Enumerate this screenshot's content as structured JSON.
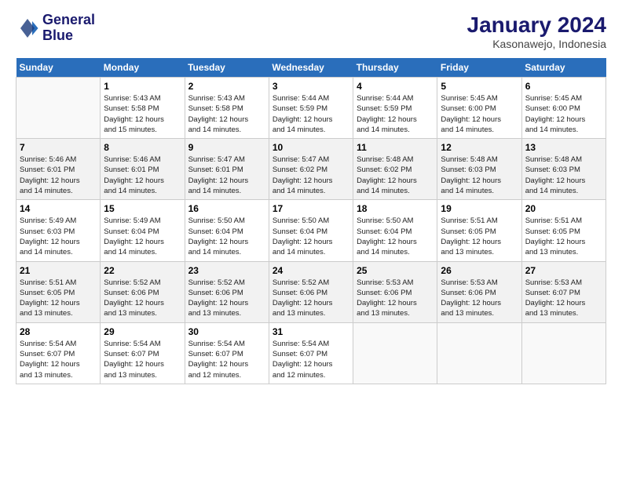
{
  "app": {
    "logo_line1": "General",
    "logo_line2": "Blue"
  },
  "calendar": {
    "title": "January 2024",
    "subtitle": "Kasonawejo, Indonesia",
    "headers": [
      "Sunday",
      "Monday",
      "Tuesday",
      "Wednesday",
      "Thursday",
      "Friday",
      "Saturday"
    ],
    "weeks": [
      [
        {
          "num": "",
          "info": ""
        },
        {
          "num": "1",
          "info": "Sunrise: 5:43 AM\nSunset: 5:58 PM\nDaylight: 12 hours\nand 15 minutes."
        },
        {
          "num": "2",
          "info": "Sunrise: 5:43 AM\nSunset: 5:58 PM\nDaylight: 12 hours\nand 14 minutes."
        },
        {
          "num": "3",
          "info": "Sunrise: 5:44 AM\nSunset: 5:59 PM\nDaylight: 12 hours\nand 14 minutes."
        },
        {
          "num": "4",
          "info": "Sunrise: 5:44 AM\nSunset: 5:59 PM\nDaylight: 12 hours\nand 14 minutes."
        },
        {
          "num": "5",
          "info": "Sunrise: 5:45 AM\nSunset: 6:00 PM\nDaylight: 12 hours\nand 14 minutes."
        },
        {
          "num": "6",
          "info": "Sunrise: 5:45 AM\nSunset: 6:00 PM\nDaylight: 12 hours\nand 14 minutes."
        }
      ],
      [
        {
          "num": "7",
          "info": "Sunrise: 5:46 AM\nSunset: 6:01 PM\nDaylight: 12 hours\nand 14 minutes."
        },
        {
          "num": "8",
          "info": "Sunrise: 5:46 AM\nSunset: 6:01 PM\nDaylight: 12 hours\nand 14 minutes."
        },
        {
          "num": "9",
          "info": "Sunrise: 5:47 AM\nSunset: 6:01 PM\nDaylight: 12 hours\nand 14 minutes."
        },
        {
          "num": "10",
          "info": "Sunrise: 5:47 AM\nSunset: 6:02 PM\nDaylight: 12 hours\nand 14 minutes."
        },
        {
          "num": "11",
          "info": "Sunrise: 5:48 AM\nSunset: 6:02 PM\nDaylight: 12 hours\nand 14 minutes."
        },
        {
          "num": "12",
          "info": "Sunrise: 5:48 AM\nSunset: 6:03 PM\nDaylight: 12 hours\nand 14 minutes."
        },
        {
          "num": "13",
          "info": "Sunrise: 5:48 AM\nSunset: 6:03 PM\nDaylight: 12 hours\nand 14 minutes."
        }
      ],
      [
        {
          "num": "14",
          "info": "Sunrise: 5:49 AM\nSunset: 6:03 PM\nDaylight: 12 hours\nand 14 minutes."
        },
        {
          "num": "15",
          "info": "Sunrise: 5:49 AM\nSunset: 6:04 PM\nDaylight: 12 hours\nand 14 minutes."
        },
        {
          "num": "16",
          "info": "Sunrise: 5:50 AM\nSunset: 6:04 PM\nDaylight: 12 hours\nand 14 minutes."
        },
        {
          "num": "17",
          "info": "Sunrise: 5:50 AM\nSunset: 6:04 PM\nDaylight: 12 hours\nand 14 minutes."
        },
        {
          "num": "18",
          "info": "Sunrise: 5:50 AM\nSunset: 6:04 PM\nDaylight: 12 hours\nand 14 minutes."
        },
        {
          "num": "19",
          "info": "Sunrise: 5:51 AM\nSunset: 6:05 PM\nDaylight: 12 hours\nand 13 minutes."
        },
        {
          "num": "20",
          "info": "Sunrise: 5:51 AM\nSunset: 6:05 PM\nDaylight: 12 hours\nand 13 minutes."
        }
      ],
      [
        {
          "num": "21",
          "info": "Sunrise: 5:51 AM\nSunset: 6:05 PM\nDaylight: 12 hours\nand 13 minutes."
        },
        {
          "num": "22",
          "info": "Sunrise: 5:52 AM\nSunset: 6:06 PM\nDaylight: 12 hours\nand 13 minutes."
        },
        {
          "num": "23",
          "info": "Sunrise: 5:52 AM\nSunset: 6:06 PM\nDaylight: 12 hours\nand 13 minutes."
        },
        {
          "num": "24",
          "info": "Sunrise: 5:52 AM\nSunset: 6:06 PM\nDaylight: 12 hours\nand 13 minutes."
        },
        {
          "num": "25",
          "info": "Sunrise: 5:53 AM\nSunset: 6:06 PM\nDaylight: 12 hours\nand 13 minutes."
        },
        {
          "num": "26",
          "info": "Sunrise: 5:53 AM\nSunset: 6:06 PM\nDaylight: 12 hours\nand 13 minutes."
        },
        {
          "num": "27",
          "info": "Sunrise: 5:53 AM\nSunset: 6:07 PM\nDaylight: 12 hours\nand 13 minutes."
        }
      ],
      [
        {
          "num": "28",
          "info": "Sunrise: 5:54 AM\nSunset: 6:07 PM\nDaylight: 12 hours\nand 13 minutes."
        },
        {
          "num": "29",
          "info": "Sunrise: 5:54 AM\nSunset: 6:07 PM\nDaylight: 12 hours\nand 13 minutes."
        },
        {
          "num": "30",
          "info": "Sunrise: 5:54 AM\nSunset: 6:07 PM\nDaylight: 12 hours\nand 12 minutes."
        },
        {
          "num": "31",
          "info": "Sunrise: 5:54 AM\nSunset: 6:07 PM\nDaylight: 12 hours\nand 12 minutes."
        },
        {
          "num": "",
          "info": ""
        },
        {
          "num": "",
          "info": ""
        },
        {
          "num": "",
          "info": ""
        }
      ]
    ]
  }
}
